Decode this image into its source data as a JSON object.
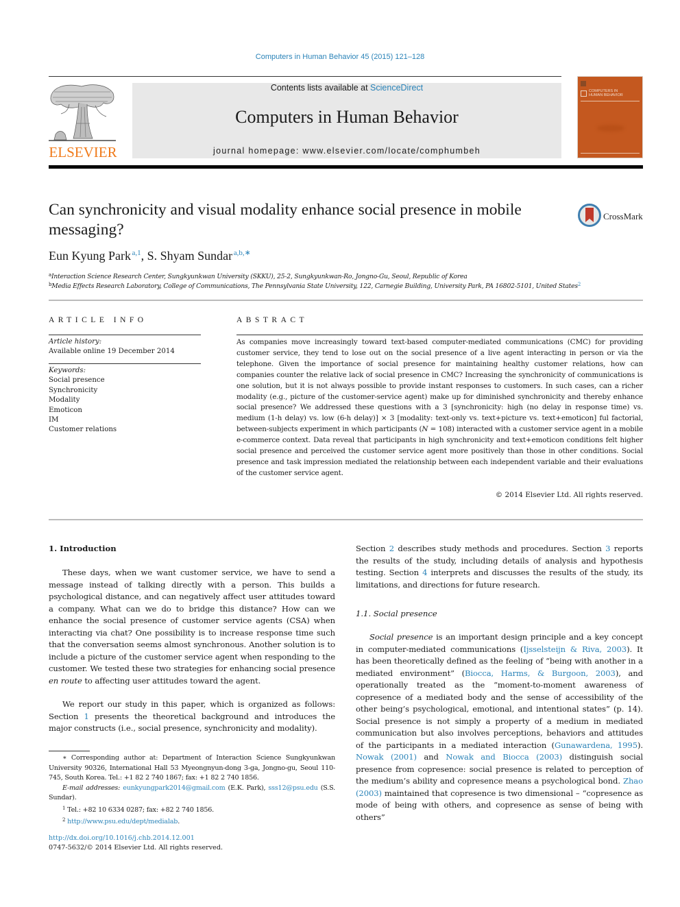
{
  "header": {
    "citation": "Computers in Human Behavior 45 (2015) 121–128",
    "contents_prefix": "Contents lists available at ",
    "contents_link": "ScienceDirect",
    "journal_name": "Computers in Human Behavior",
    "homepage": "journal homepage: www.elsevier.com/locate/comphumbeh",
    "publisher_logo": "ELSEVIER",
    "cover_title_line1": "COMPUTERS IN",
    "cover_title_line2": "HUMAN BEHAVIOR",
    "colors": {
      "link": "#2a83b8",
      "elsevier_orange": "#f07a1a",
      "cover": "#c4581f",
      "masthead_bg": "#e8e8e8"
    }
  },
  "article": {
    "title": "Can synchronicity and visual modality enhance social presence in mobile messaging?",
    "crossmark_label": "CrossMark",
    "authors": [
      {
        "name": "Eun Kyung Park",
        "marks": "a,1"
      },
      {
        "name": "S. Shyam Sundar",
        "marks": "a,b,∗"
      }
    ],
    "author_separator": ", ",
    "affiliations": [
      {
        "mark": "a",
        "text": "Interaction Science Research Center, Sungkyunkwan University (SKKU), 25-2, Sungkyunkwan-Ro, Jongno-Gu, Seoul, Republic of Korea"
      },
      {
        "mark": "b",
        "text": "Media Effects Research Laboratory, College of Communications, The Pennsylvania State University, 122, Carnegie Building, University Park, PA 16802-5101, United States",
        "footnote_ref": "2"
      }
    ]
  },
  "article_info": {
    "heading": "ARTICLE INFO",
    "history_label": "Article history:",
    "history_value": "Available online 19 December 2014",
    "keywords_label": "Keywords:",
    "keywords": [
      "Social presence",
      "Synchronicity",
      "Modality",
      "Emoticon",
      "IM",
      "Customer relations"
    ]
  },
  "abstract": {
    "heading": "ABSTRACT",
    "text_part1": "As companies move increasingly toward text-based computer-mediated communications (CMC) for providing customer service, they tend to lose out on the social presence of a live agent interacting in person or via the telephone. Given the importance of social presence for maintaining healthy customer relations, how can companies counter the relative lack of social presence in CMC? Increasing the synchronicity of communications is one solution, but it is not always possible to provide instant responses to customers. In such cases, can a richer modality (e.g., picture of the customer-service agent) make up for diminished synchronicity and thereby enhance social presence? We addressed these questions with a 3 [synchronicity: high (no delay in response time) vs. medium (1-h delay) vs. low (6-h delay)] × 3 [modality: text-only vs. text+picture vs. text+emoticon] ful factorial, between-subjects experiment in which participants (",
    "n_symbol": "N",
    "text_part2": " = 108) interacted with a customer service agent in a mobile e-commerce context. Data reveal that participants in high synchronicity and text+emoticon conditions felt higher social presence and perceived the customer service agent more positively than those in other conditions. Social presence and task impression mediated the relationship between each independent variable and their evaluations of the customer service agent.",
    "copyright": "© 2014 Elsevier Ltd. All rights reserved."
  },
  "body": {
    "section1_heading": "1. Introduction",
    "intro_p1_a": "These days, when we want customer service, we have to send a message instead of talking directly with a person. This builds a psychological distance, and can negatively affect user attitudes toward a company. What can we do to bridge this distance? How can we enhance the social presence of customer service agents (CSA) when interacting via chat? One possibility is to increase response time such that the conversation seems almost synchronous. Another solution is to include a picture of the customer service agent when responding to the customer. We tested these two strategies for enhancing social presence ",
    "intro_p1_italic": "en route",
    "intro_p1_b": " to affecting user attitudes toward the agent.",
    "intro_p2_a": "We report our study in this paper, which is organized as follows: Section ",
    "intro_p2_ref1": "1",
    "intro_p2_b": " presents the theoretical background and introduces the major constructs (i.e., social presence, synchronicity and modality).",
    "right_p1_a": "Section ",
    "right_p1_ref2": "2",
    "right_p1_b": " describes study methods and procedures. Section ",
    "right_p1_ref3": "3",
    "right_p1_c": " reports the results of the study, including details of analysis and hypothesis testing. Section ",
    "right_p1_ref4": "4",
    "right_p1_d": " interprets and discusses the results of the study, its limitations, and directions for future research.",
    "section11_heading": "1.1. Social presence",
    "sp_italic": "Social presence",
    "sp_a": " is an important design principle and a key concept in computer-mediated communications (",
    "sp_cite1": "Ijsselsteijn & Riva, 2003",
    "sp_b": "). It has been theoretically defined as the feeling of “being with another in a mediated environment” (",
    "sp_cite2": "Biocca, Harms, & Burgoon, 2003",
    "sp_c": "), and operationally treated as the “moment-to-moment awareness of copresence of a mediated body and the sense of accessibility of the other being’s psychological, emotional, and intentional states” (p. 14). Social presence is not simply a property of a medium in mediated communication but also involves perceptions, behaviors and attitudes of the participants in a mediated interaction (",
    "sp_cite3": "Gunawardena, 1995",
    "sp_d": "). ",
    "sp_cite4": "Nowak (2001)",
    "sp_e": " and ",
    "sp_cite5": "Nowak and Biocca (2003)",
    "sp_f": " distinguish social presence from copresence: social presence is related to perception of the medium’s ability and copresence means a psychological bond. ",
    "sp_cite6": "Zhao (2003)",
    "sp_g": " maintained that copresence is two dimensional – “copresence as mode of being with others, and copresence as sense of being with others”"
  },
  "footnotes": {
    "corresponding_mark": "∗",
    "corresponding": " Corresponding author at: Department of Interaction Science Sungkyunkwan University 90326, International Hall 53 Myeongnyun-dong 3-ga, Jongno-gu, Seoul 110-745, South Korea. Tel.: +1 82 2 740 1867; fax: +1 82 2 740 1856.",
    "email_label": "E-mail addresses:",
    "email1": "eunkyungpark2014@gmail.com",
    "email1_owner": " (E.K. Park), ",
    "email2": "sss12@psu.edu",
    "email2_owner": " (S.S. Sundar).",
    "fn1_mark": "1",
    "fn1": " Tel.: +82 10 6334 0287; fax: +82 2 740 1856.",
    "fn2_mark": "2",
    "fn2": "http://www.psu.edu/dept/medialab",
    "fn2_end": "."
  },
  "footer": {
    "doi": "http://dx.doi.org/10.1016/j.chb.2014.12.001",
    "issn": "0747-5632/© 2014 Elsevier Ltd. All rights reserved."
  }
}
